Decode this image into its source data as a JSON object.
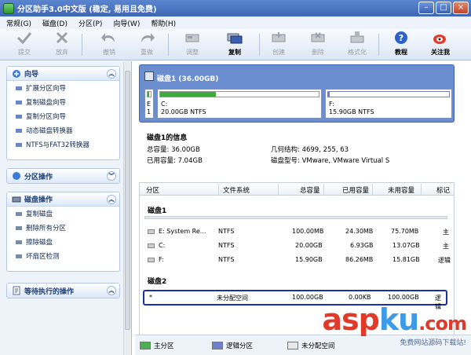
{
  "window": {
    "title": "分区助手3.0中文版 (稳定, 易用且免费)",
    "minimize": "–",
    "maximize": "□",
    "close": "×"
  },
  "menu": [
    "常规(G)",
    "磁盘(D)",
    "分区(P)",
    "向导(W)",
    "帮助(H)"
  ],
  "toolbar": {
    "commit": "提交",
    "discard": "放弃",
    "undo": "撤销",
    "redo": "重做",
    "adjust": "调整",
    "copy": "复制",
    "create": "创建",
    "delete": "删除",
    "format": "格式化",
    "tutorial": "教程",
    "follow": "关注我"
  },
  "sidebar": {
    "wizard": {
      "title": "向导",
      "items": [
        "扩展分区向导",
        "复制磁盘向导",
        "复制分区向导",
        "动态磁盘转换器",
        "NTFS与FAT32转换器"
      ]
    },
    "partition_ops": {
      "title": "分区操作"
    },
    "disk_ops": {
      "title": "磁盘操作",
      "items": [
        "复制磁盘",
        "删除所有分区",
        "擦除磁盘",
        "坏扇区检测"
      ]
    },
    "pending": {
      "title": "等待执行的操作"
    }
  },
  "diskcard": {
    "title": "磁盘1 (36.00GB)",
    "small_part": {
      "letter": "E",
      "size": "1"
    },
    "c": {
      "label": "C:",
      "info": "20.00GB NTFS",
      "fill": 0.35
    },
    "f": {
      "label": "F:",
      "info": "15.90GB NTFS",
      "fill": 0.01
    }
  },
  "info": {
    "title": "磁盘1的信息",
    "total": "总容量: 36.00GB",
    "used": "已用容量: 7.04GB",
    "geometry": "几何结构: 4699, 255, 63",
    "model": "磁盘型号: VMware, VMware Virtual S"
  },
  "table": {
    "headers": [
      "分区",
      "文件系统",
      "总容量",
      "已用容量",
      "未用容量",
      "标记"
    ],
    "disk1": "磁盘1",
    "disk2": "磁盘2",
    "rows": [
      [
        "E:  System Re...",
        "NTFS",
        "100.00MB",
        "24.30MB",
        "75.70MB",
        "主"
      ],
      [
        "C:",
        "NTFS",
        "20.00GB",
        "6.93GB",
        "13.07GB",
        "主"
      ],
      [
        "F:",
        "NTFS",
        "15.90GB",
        "86.26MB",
        "15.81GB",
        "逻辑"
      ]
    ],
    "disk2_row": [
      "*",
      "未分配空间",
      "100.00GB",
      "0.00KB",
      "100.00GB",
      "逻辑"
    ]
  },
  "legend": {
    "primary": "主分区",
    "logical": "逻辑分区",
    "unallocated": "未分配空间"
  },
  "watermark": {
    "brand_a": "asp",
    "brand_b": "ku",
    "brand_c": ".com",
    "tagline": "免费网站源码下载站!"
  },
  "colors": {
    "primary": "#4caf50",
    "logical": "#6f7fcc",
    "unallocated": "#e8e8e8",
    "accent": "#3f66b3"
  }
}
